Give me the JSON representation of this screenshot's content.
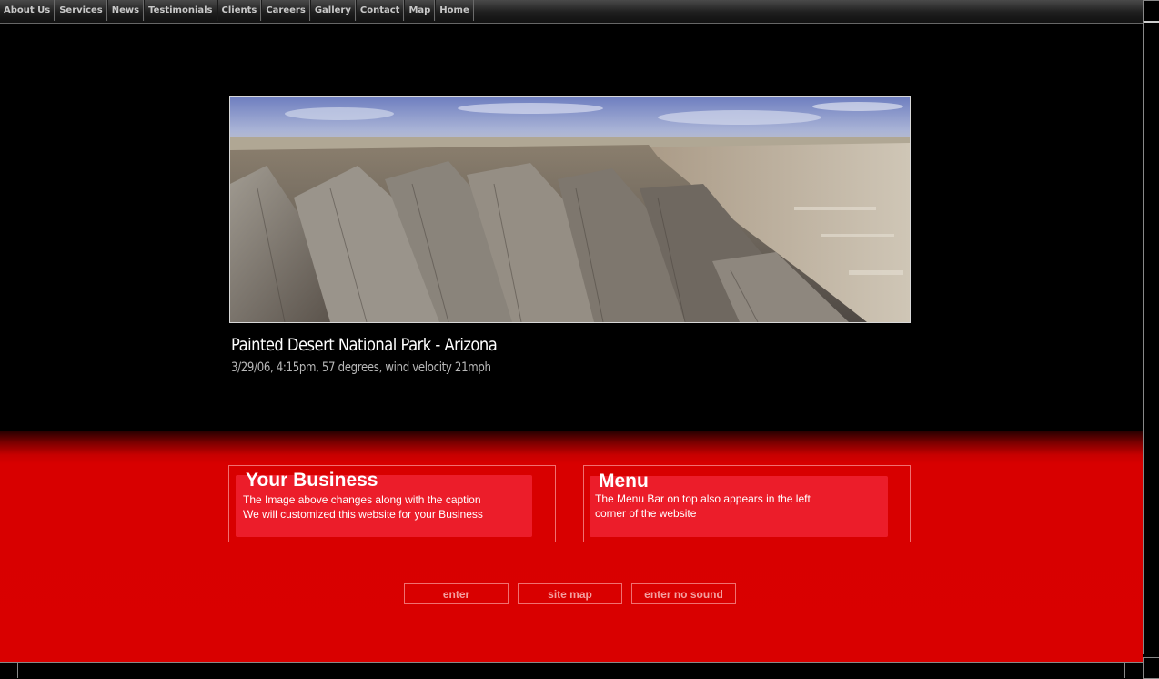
{
  "nav": {
    "items": [
      "About Us",
      "Services",
      "News",
      "Testimonials",
      "Clients",
      "Careers",
      "Gallery",
      "Contact",
      "Map",
      "Home"
    ]
  },
  "hero": {
    "image": "painted-desert-landscape-photo",
    "title": "Painted Desert National Park - Arizona",
    "subtitle": "3/29/06, 4:15pm, 57 degrees, wind velocity 21mph"
  },
  "panels": {
    "business": {
      "title": "Your Business",
      "line1": "The Image above changes along with the caption",
      "line2": "We will customized this website for your Business"
    },
    "menu": {
      "title": "Menu",
      "line1": "The Menu Bar on top also appears in the left",
      "line2": "corner of the website"
    }
  },
  "buttons": {
    "enter": "enter",
    "site_map": "site map",
    "enter_no_sound": "enter no sound"
  },
  "colors": {
    "background": "#000000",
    "accent_red": "#d90000",
    "panel_fill": "#ec1d2a"
  }
}
